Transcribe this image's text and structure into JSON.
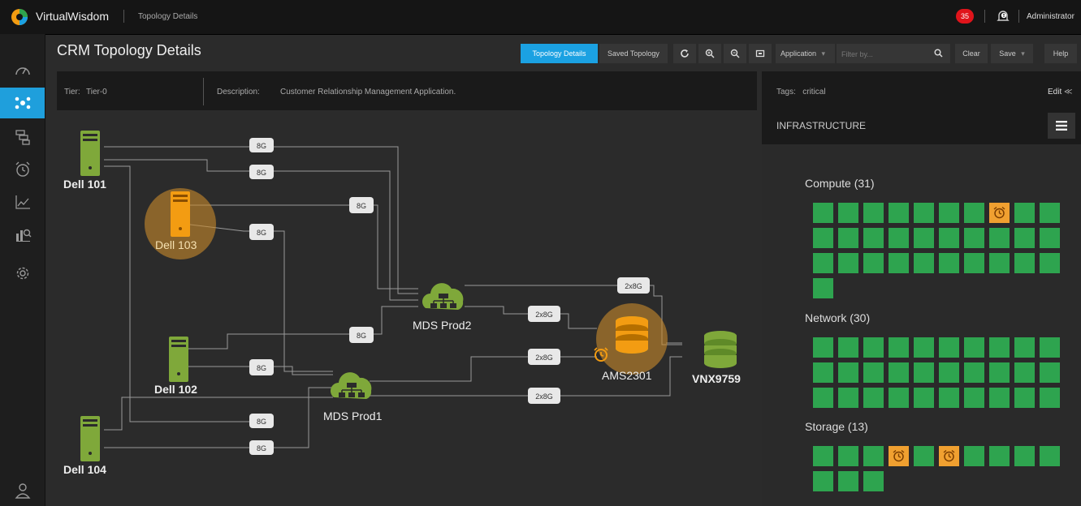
{
  "app": {
    "name": "VirtualWisdom",
    "breadcrumb": "Topology Details",
    "alert_count": "35",
    "user": "Administrator"
  },
  "page": {
    "title": "CRM Topology Details"
  },
  "toolbar": {
    "tab_topology": "Topology Details",
    "tab_saved": "Saved Topology",
    "application_label": "Application",
    "filter_placeholder": "Filter by...",
    "clear": "Clear",
    "save": "Save",
    "help": "Help"
  },
  "info": {
    "tier_label": "Tier:",
    "tier_value": "Tier-0",
    "description_label": "Description:",
    "description_value": "Customer Relationship Management Application.",
    "tags_label": "Tags:",
    "tags_value": "critical",
    "edit": "Edit"
  },
  "infrastructure": {
    "title": "INFRASTRUCTURE",
    "groups": [
      {
        "label": "Compute (31)",
        "count": 31,
        "warning_indices": [
          7
        ]
      },
      {
        "label": "Network (30)",
        "count": 30,
        "warning_indices": []
      },
      {
        "label": "Storage (13)",
        "count": 13,
        "warning_indices": [
          3,
          5
        ]
      }
    ]
  },
  "topology": {
    "nodes": {
      "dell101": "Dell 101",
      "dell103": "Dell 103",
      "dell102": "Dell 102",
      "dell104": "Dell 104",
      "mds_prod2": "MDS Prod2",
      "mds_prod1": "MDS Prod1",
      "ams2301": "AMS2301",
      "vnx9759": "VNX9759"
    },
    "link_labels": {
      "l1": "8G",
      "l2": "8G",
      "l3": "8G",
      "l4": "8G",
      "l5": "8G",
      "l6": "8G",
      "l7": "8G",
      "l8": "8G",
      "l9": "2x8G",
      "l10": "2x8G",
      "l11": "2x8G",
      "l12": "2x8G"
    }
  },
  "colors": {
    "accent": "#1ba1e2",
    "ok": "#2ea44f",
    "warning": "#f0a030",
    "alert": "#e0141b",
    "node": "#7fa83a"
  }
}
